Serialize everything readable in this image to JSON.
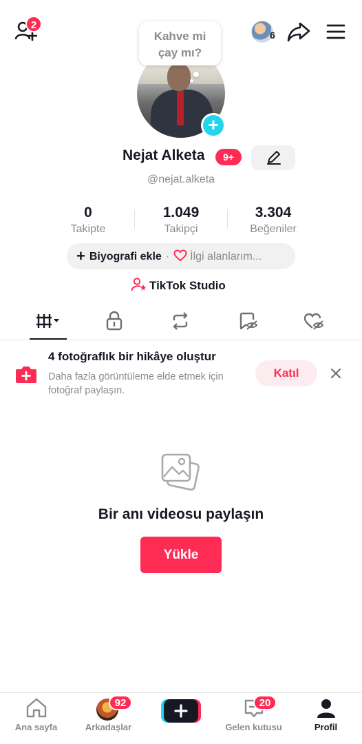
{
  "topbar": {
    "add_friends_badge": "2",
    "story_viewers_count": "6"
  },
  "profile": {
    "bubble_text": "Kahve mi\nçay mı?",
    "bubble_line1": "Kahve mi",
    "bubble_line2": "çay mı?",
    "name": "Nejat Alketa",
    "name_badge": "9+",
    "handle": "@nejat.alketa",
    "stats": [
      {
        "value": "0",
        "label": "Takipte"
      },
      {
        "value": "1.049",
        "label": "Takipçi"
      },
      {
        "value": "3.304",
        "label": "Beğeniler"
      }
    ],
    "bio_add_label": "Biyografi ekle",
    "bio_separator": "·",
    "interests_label": "İlgi alanlarım...",
    "studio_label": "TikTok Studio"
  },
  "tabs": [
    "videos-grid",
    "private",
    "reposts",
    "favorites",
    "liked"
  ],
  "story_banner": {
    "title": "4 fotoğraflık bir hikâye oluştur",
    "subtitle": "Daha fazla görüntüleme elde etmek için fotoğraf paylaşın.",
    "join_label": "Katıl"
  },
  "empty_state": {
    "title": "Bir anı videosu paylaşın",
    "upload_label": "Yükle"
  },
  "bottom_nav": {
    "home_label": "Ana sayfa",
    "friends_label": "Arkadaşlar",
    "friends_badge": "92",
    "inbox_label": "Gelen kutusu",
    "inbox_badge": "20",
    "profile_label": "Profil"
  },
  "colors": {
    "accent": "#fe2c55",
    "cyan": "#20d5ec",
    "text": "#161823",
    "muted": "#8a8b91"
  }
}
